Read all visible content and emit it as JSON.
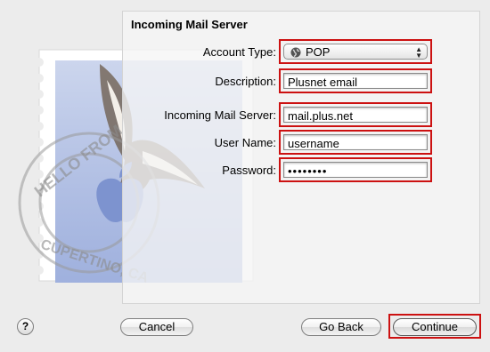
{
  "panel": {
    "title": "Incoming Mail Server"
  },
  "stamp_text": {
    "top": "HELLO FROM",
    "bottom": "CUPERTINO, CA"
  },
  "form": {
    "account_type": {
      "label": "Account Type:",
      "value": "POP",
      "icon": "globe-icon"
    },
    "description": {
      "label": "Description:",
      "value": "Plusnet email"
    },
    "server": {
      "label": "Incoming Mail Server:",
      "value": "mail.plus.net"
    },
    "username": {
      "label": "User Name:",
      "value": "username"
    },
    "password": {
      "label": "Password:",
      "value": "••••••••"
    }
  },
  "buttons": {
    "help": "?",
    "cancel": "Cancel",
    "go_back": "Go Back",
    "continue": "Continue"
  },
  "colors": {
    "highlight": "#cc1111",
    "background": "#ececec"
  }
}
